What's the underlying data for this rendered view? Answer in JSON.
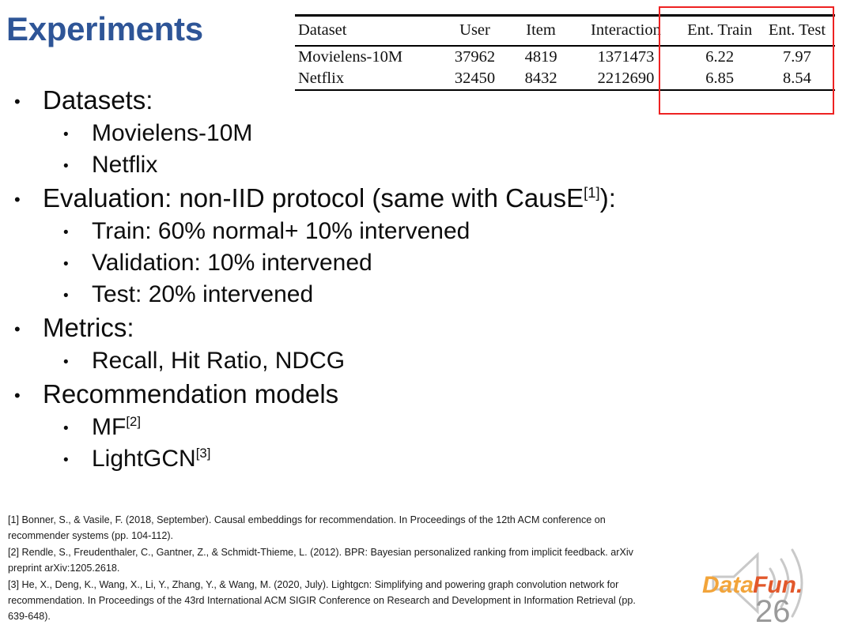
{
  "slide": {
    "title": "Experiments",
    "title_color": "#2E5597",
    "page_number": "26"
  },
  "table": {
    "highlight_color": "#EE2222",
    "columns": [
      "Dataset",
      "User",
      "Item",
      "Interaction",
      "Ent. Train",
      "Ent. Test"
    ],
    "rows": [
      {
        "dataset": "Movielens-10M",
        "user": "37962",
        "item": "4819",
        "interaction": "1371473",
        "ent_train": "6.22",
        "ent_test": "7.97"
      },
      {
        "dataset": "Netflix",
        "user": "32450",
        "item": "8432",
        "interaction": "2212690",
        "ent_train": "6.85",
        "ent_test": "8.54"
      }
    ]
  },
  "bullets": {
    "datasets_label": "Datasets:",
    "dataset_1": "Movielens-10M",
    "dataset_2": "Netflix",
    "evaluation_pre": "Evaluation: non-IID protocol (same with CausE",
    "evaluation_ref": "[1]",
    "evaluation_post": "):",
    "train_split": "Train: 60% normal+ 10% intervened",
    "validation_split": "Validation: 10% intervened",
    "test_split": "Test: 20% intervened",
    "metrics_label": "Metrics:",
    "metrics_value": "Recall, Hit Ratio, NDCG",
    "models_label": "Recommendation models",
    "model_1": "MF",
    "model_1_ref": "[2]",
    "model_2": "LightGCN",
    "model_2_ref": "[3]"
  },
  "references": {
    "ref1_line1": "[1] Bonner, S., & Vasile, F. (2018, September). Causal embeddings for recommendation. In Proceedings of the 12th ACM conference on",
    "ref1_line2": "recommender systems (pp. 104-112).",
    "ref2_line1": "[2] Rendle, S., Freudenthaler, C., Gantner, Z., & Schmidt-Thieme, L. (2012). BPR: Bayesian personalized ranking from implicit feedback. arXiv",
    "ref2_line2": "preprint arXiv:1205.2618.",
    "ref3_line1": "[3] He, X., Deng, K., Wang, X., Li, Y., Zhang, Y., & Wang, M. (2020, July). Lightgcn: Simplifying and powering graph convolution network for",
    "ref3_line2": "recommendation. In Proceedings of the 43rd International ACM SIGIR Conference on Research and Development in Information Retrieval (pp.",
    "ref3_line3": "639-648)."
  },
  "watermark": {
    "brand": "DataFun",
    "brand_color_left": "#F2A43A",
    "brand_color_right": "#E2582B"
  }
}
